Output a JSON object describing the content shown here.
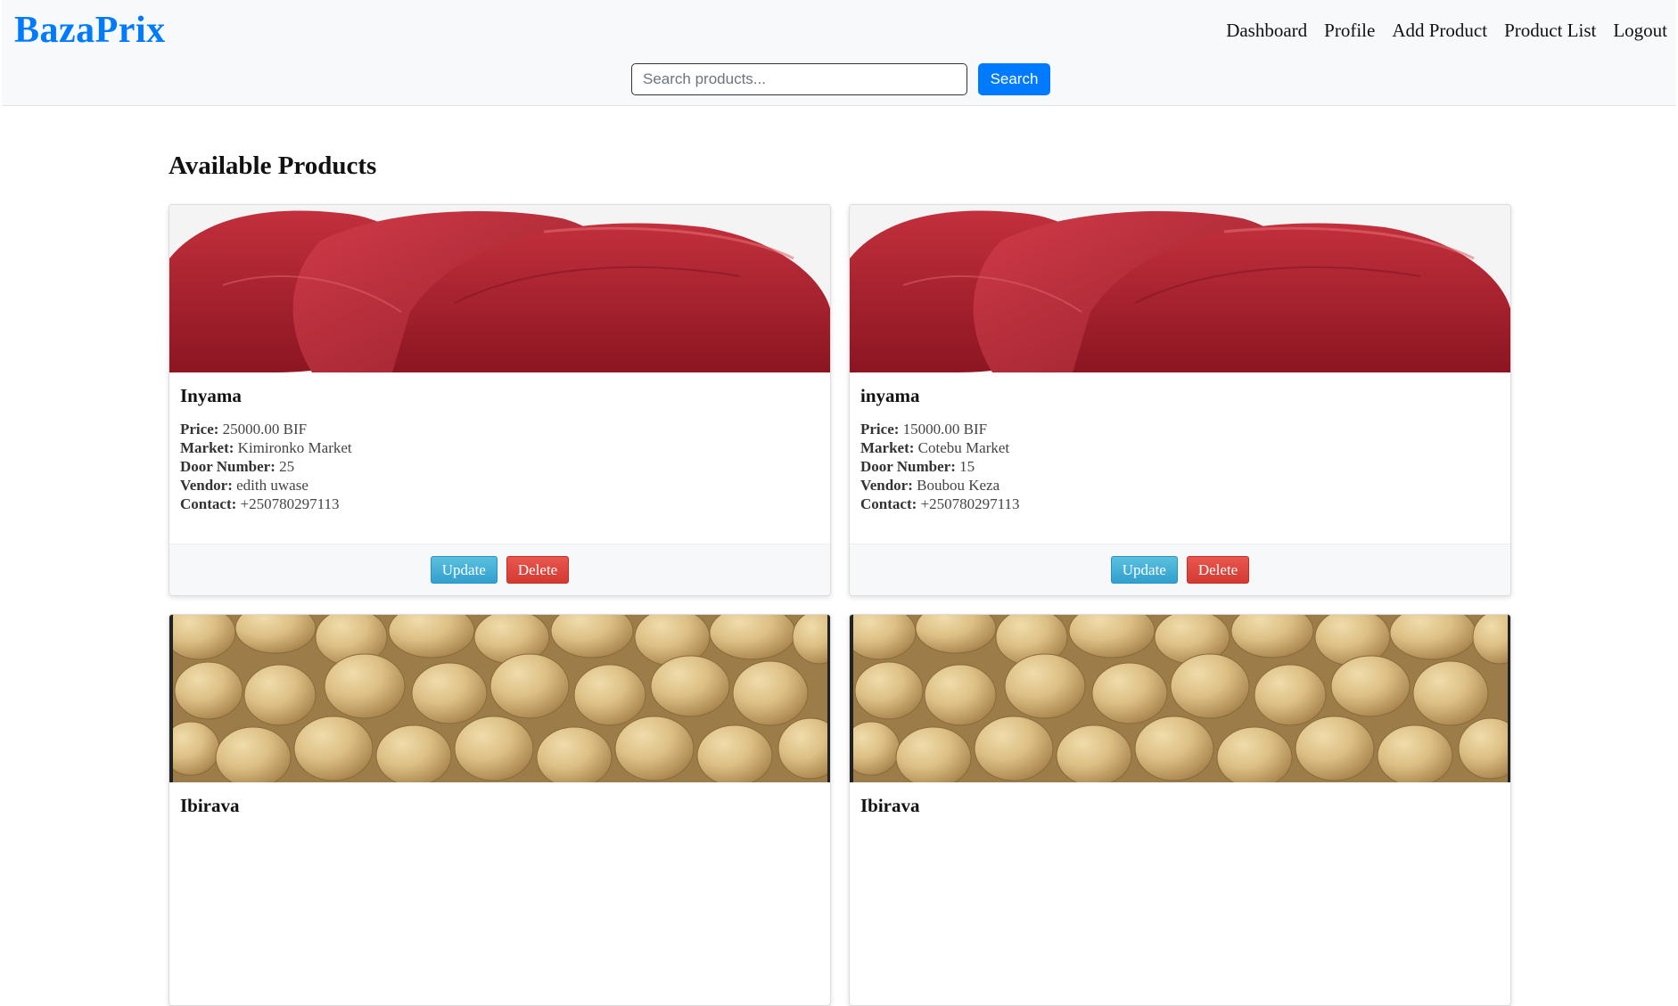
{
  "brand": "BazaPrix",
  "nav": [
    "Dashboard",
    "Profile",
    "Add Product",
    "Product List",
    "Logout"
  ],
  "search": {
    "placeholder": "Search products...",
    "button": "Search"
  },
  "page_title": "Available Products",
  "labels": {
    "price": "Price:",
    "market": "Market:",
    "door": "Door Number:",
    "vendor": "Vendor:",
    "contact": "Contact:",
    "update": "Update",
    "delete": "Delete"
  },
  "products": [
    {
      "name": "Inyama",
      "image": "meat-photo",
      "price": "25000.00 BIF",
      "market": "Kimironko Market",
      "door": "25",
      "vendor": "edith uwase",
      "contact": "+250780297113"
    },
    {
      "name": "inyama",
      "image": "meat-photo",
      "price": "15000.00 BIF",
      "market": "Cotebu Market",
      "door": "15",
      "vendor": "Boubou Keza",
      "contact": "+250780297113"
    },
    {
      "name": "Ibirava",
      "image": "potato-photo"
    },
    {
      "name": "Ibirava",
      "image": "potato-photo"
    }
  ],
  "colors": {
    "brand": "#007bff",
    "update": "#31a0ce",
    "delete": "#d33a32"
  }
}
